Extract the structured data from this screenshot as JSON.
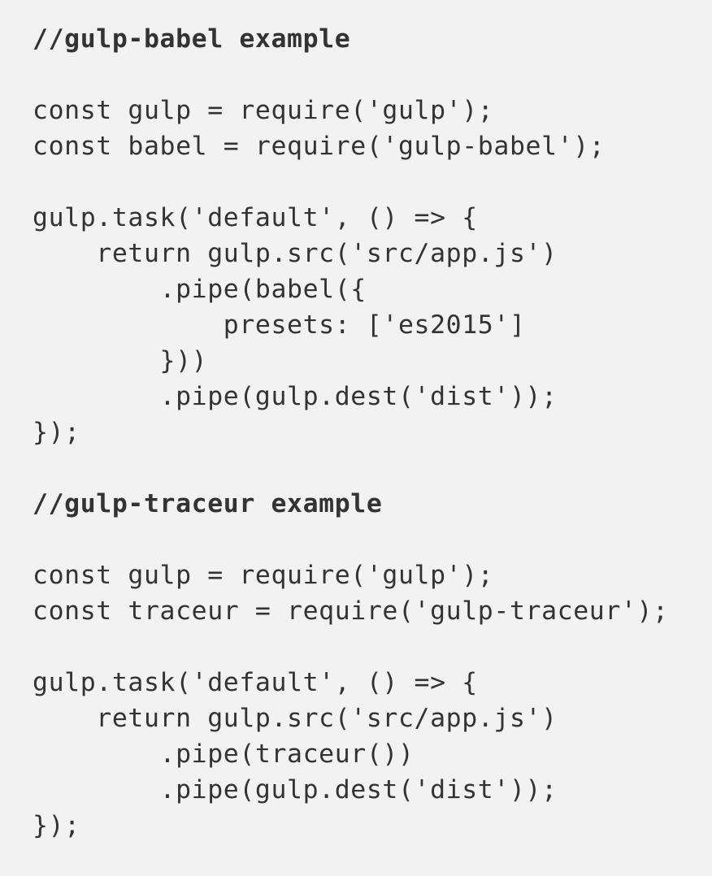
{
  "code": {
    "lines": [
      "//gulp-babel example",
      "",
      "const gulp = require('gulp');",
      "const babel = require('gulp-babel');",
      "",
      "gulp.task('default', () => {",
      "    return gulp.src('src/app.js')",
      "        .pipe(babel({",
      "            presets: ['es2015']",
      "        }))",
      "        .pipe(gulp.dest('dist'));",
      "});",
      "",
      "//gulp-traceur example",
      "",
      "const gulp = require('gulp');",
      "const traceur = require('gulp-traceur');",
      "",
      "gulp.task('default', () => {",
      "    return gulp.src('src/app.js')",
      "        .pipe(traceur())",
      "        .pipe(gulp.dest('dist'));",
      "});"
    ]
  }
}
